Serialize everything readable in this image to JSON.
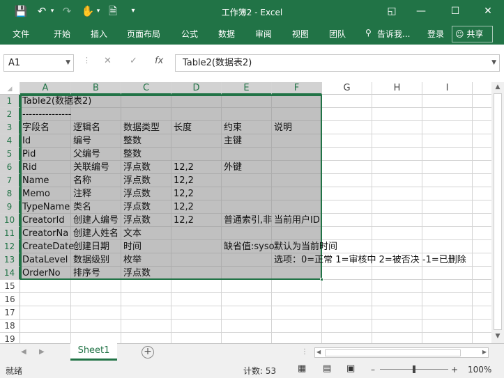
{
  "app": {
    "title": "工作簿2 - Excel"
  },
  "ribbon": {
    "tabs": [
      "文件",
      "开始",
      "插入",
      "页面布局",
      "公式",
      "数据",
      "审阅",
      "视图",
      "团队"
    ],
    "tell_me": "告诉我...",
    "login": "登录",
    "share": "共享"
  },
  "formula_bar": {
    "name_box": "A1",
    "content": "Table2(数据表2)"
  },
  "columns": [
    "A",
    "B",
    "C",
    "D",
    "E",
    "F",
    "G",
    "H",
    "I"
  ],
  "rows": [
    "1",
    "2",
    "3",
    "4",
    "5",
    "6",
    "7",
    "8",
    "9",
    "10",
    "11",
    "12",
    "13",
    "14",
    "15",
    "16",
    "17",
    "18",
    "19"
  ],
  "cells": {
    "r1": [
      "Table2(数据表2)",
      "",
      "",
      "",
      "",
      ""
    ],
    "r2": [
      "---------------",
      "",
      "",
      "",
      "",
      ""
    ],
    "r3": [
      "字段名",
      "逻辑名",
      "数据类型",
      "长度",
      "约束",
      "说明"
    ],
    "r4": [
      "Id",
      "编号",
      "整数",
      "",
      "主键",
      ""
    ],
    "r5": [
      "Pid",
      "父编号",
      "整数",
      "",
      "",
      ""
    ],
    "r6": [
      "Rid",
      "关联编号",
      "浮点数",
      "12,2",
      "外键",
      ""
    ],
    "r7": [
      "Name",
      "名称",
      "浮点数",
      "12,2",
      "",
      ""
    ],
    "r8": [
      "Memo",
      "注释",
      "浮点数",
      "12,2",
      "",
      ""
    ],
    "r9": [
      "TypeName",
      "类名",
      "浮点数",
      "12,2",
      "",
      ""
    ],
    "r10": [
      "CreatorId",
      "创建人编号",
      "浮点数",
      "12,2",
      "普通索引,非",
      "当前用户ID"
    ],
    "r11": [
      "CreatorNa",
      "创建人姓名",
      "文本",
      "",
      "",
      ""
    ],
    "r12": [
      "CreateDate",
      "创建日期",
      "时间",
      "",
      "缺省值:syso",
      "默认为当前时间"
    ],
    "r13": [
      "DataLevel",
      "数据级别",
      "枚举",
      "",
      "",
      "选项：0=正常 1=审核中 2=被否决 -1=已删除"
    ],
    "r14": [
      "OrderNo",
      "排序号",
      "浮点数",
      "",
      "",
      ""
    ]
  },
  "sheet": {
    "tab": "Sheet1"
  },
  "status": {
    "mode": "就绪",
    "count": "计数: 53",
    "zoom": "100%"
  }
}
